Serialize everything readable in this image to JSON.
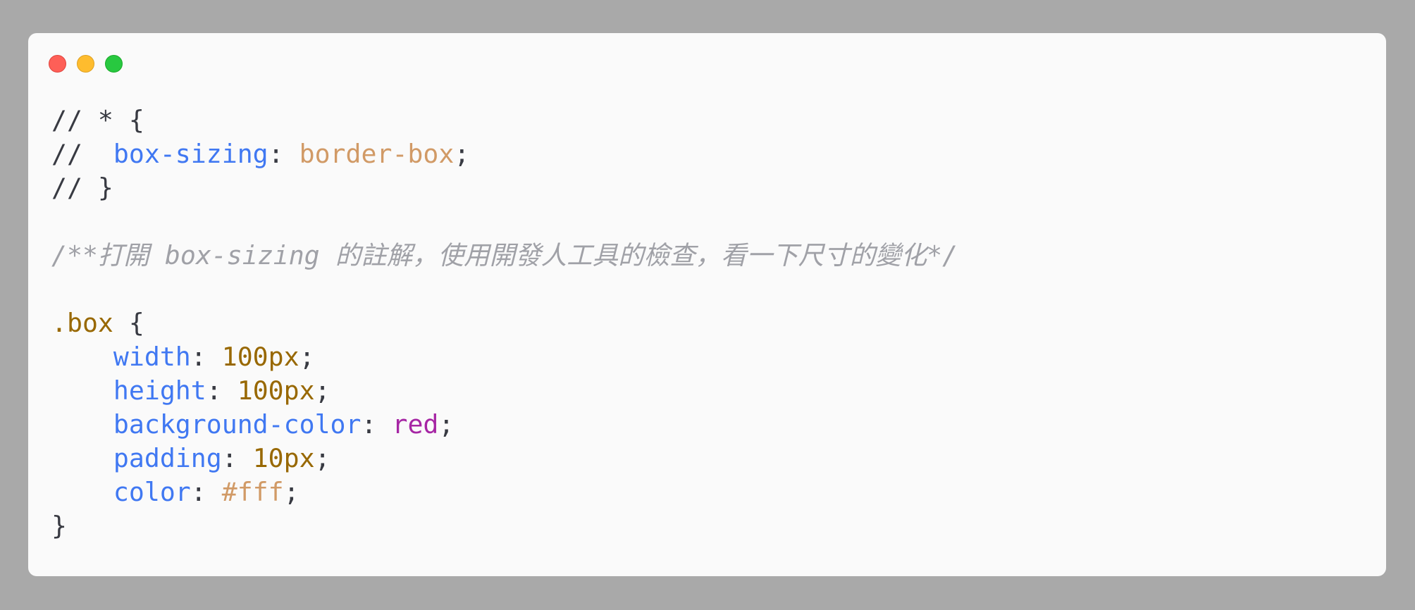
{
  "window": {
    "controls": [
      {
        "name": "close",
        "color": "#fe5f57"
      },
      {
        "name": "minimize",
        "color": "#febc2e"
      },
      {
        "name": "zoom",
        "color": "#28c840"
      }
    ]
  },
  "code": {
    "lines": [
      [
        {
          "t": "// * {",
          "c": "plain"
        }
      ],
      [
        {
          "t": "//  ",
          "c": "plain"
        },
        {
          "t": "box-sizing",
          "c": "prop"
        },
        {
          "t": ": ",
          "c": "plain"
        },
        {
          "t": "border-box",
          "c": "str"
        },
        {
          "t": ";",
          "c": "plain"
        }
      ],
      [
        {
          "t": "// }",
          "c": "plain"
        }
      ],
      [],
      [
        {
          "t": "/**打開 box-sizing 的註解，使用開發人工具的檢查，看一下尺寸的變化*/",
          "c": "cmt"
        }
      ],
      [],
      [
        {
          "t": ".box",
          "c": "sel"
        },
        {
          "t": " {",
          "c": "plain"
        }
      ],
      [
        {
          "t": "    ",
          "c": "plain"
        },
        {
          "t": "width",
          "c": "prop"
        },
        {
          "t": ": ",
          "c": "plain"
        },
        {
          "t": "100px",
          "c": "num"
        },
        {
          "t": ";",
          "c": "plain"
        }
      ],
      [
        {
          "t": "    ",
          "c": "plain"
        },
        {
          "t": "height",
          "c": "prop"
        },
        {
          "t": ": ",
          "c": "plain"
        },
        {
          "t": "100px",
          "c": "num"
        },
        {
          "t": ";",
          "c": "plain"
        }
      ],
      [
        {
          "t": "    ",
          "c": "plain"
        },
        {
          "t": "background-color",
          "c": "prop"
        },
        {
          "t": ": ",
          "c": "plain"
        },
        {
          "t": "red",
          "c": "kw"
        },
        {
          "t": ";",
          "c": "plain"
        }
      ],
      [
        {
          "t": "    ",
          "c": "plain"
        },
        {
          "t": "padding",
          "c": "prop"
        },
        {
          "t": ": ",
          "c": "plain"
        },
        {
          "t": "10px",
          "c": "num"
        },
        {
          "t": ";",
          "c": "plain"
        }
      ],
      [
        {
          "t": "    ",
          "c": "plain"
        },
        {
          "t": "color",
          "c": "prop"
        },
        {
          "t": ": ",
          "c": "plain"
        },
        {
          "t": "#fff",
          "c": "str"
        },
        {
          "t": ";",
          "c": "plain"
        }
      ],
      [
        {
          "t": "}",
          "c": "plain"
        }
      ]
    ]
  }
}
